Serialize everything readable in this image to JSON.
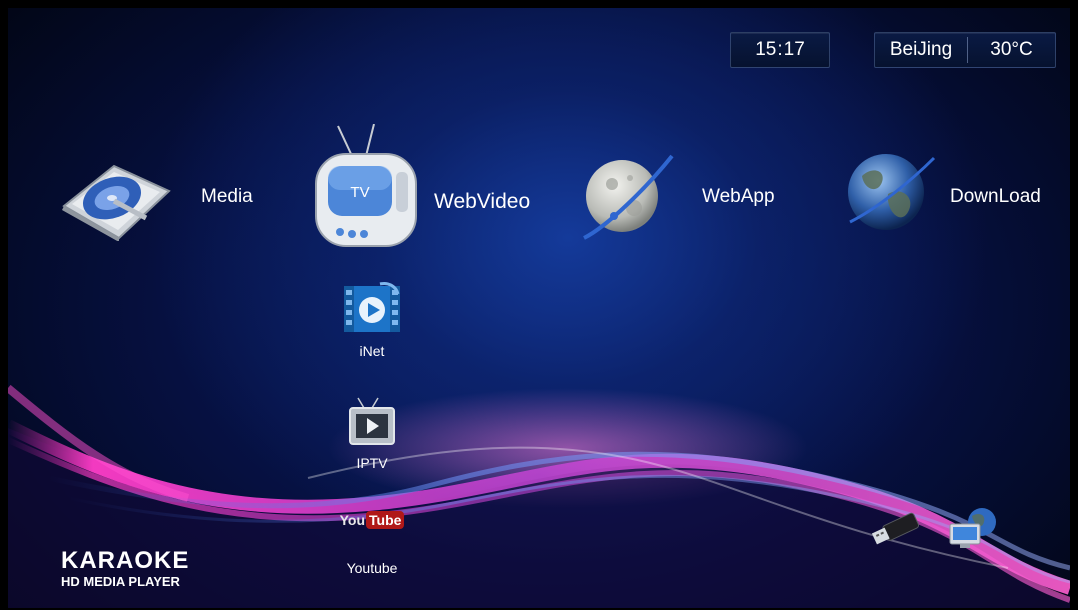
{
  "status": {
    "time_hour": "15",
    "time_sep": ":",
    "time_min": "17",
    "city": "BeiJing",
    "temperature": "30°C"
  },
  "main_menu": [
    {
      "label": "Media",
      "icon": "media-disc-icon"
    },
    {
      "label": "WebVideo",
      "icon": "tv-icon"
    },
    {
      "label": "WebApp",
      "icon": "moon-orbit-icon"
    },
    {
      "label": "DownLoad",
      "icon": "globe-download-icon"
    }
  ],
  "tv_icon_text": "TV",
  "submenu": [
    {
      "label": "iNet",
      "icon": "film-play-icon"
    },
    {
      "label": "IPTV",
      "icon": "iptv-icon"
    },
    {
      "label": "Youtube",
      "icon": "youtube-logo-icon"
    }
  ],
  "youtube_logo": {
    "left": "You",
    "right": "Tube"
  },
  "brand": {
    "title": "KARAOKE",
    "subtitle": "HD MEDIA PLAYER"
  },
  "device_icons": [
    "usb-drive-icon",
    "network-computer-icon"
  ],
  "colors": {
    "background": "#061040",
    "wave_pink": "#ff3cc8",
    "wave_blue": "#3a6fe0",
    "text": "#ffffff"
  }
}
